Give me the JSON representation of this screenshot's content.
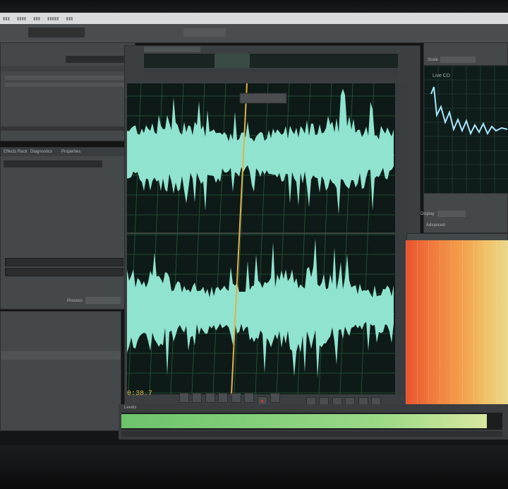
{
  "editor": {
    "time_display": "0:38.7",
    "tab_file": "",
    "tab_mixer": ""
  },
  "right_panel": {
    "scale_label": "Scale",
    "display_label": "Display",
    "advanced_label": "Advanced",
    "spec_label": "Live CD"
  },
  "left_panel": {
    "tab_effects": "Effects Rack",
    "tab_diagnostics": "Diagnostics",
    "tab_properties": "Properties",
    "process_label": "Process"
  },
  "status": {
    "text": ""
  },
  "level_meter": {
    "label": "Levels",
    "fill_fraction": 0.96
  },
  "colors": {
    "waveform": "#8fe3cf",
    "waveform_bg": "#0d1a17",
    "playhead": "#e2b14b",
    "grid": "#2b5a3a",
    "meter_green": "#7fcf7a"
  }
}
